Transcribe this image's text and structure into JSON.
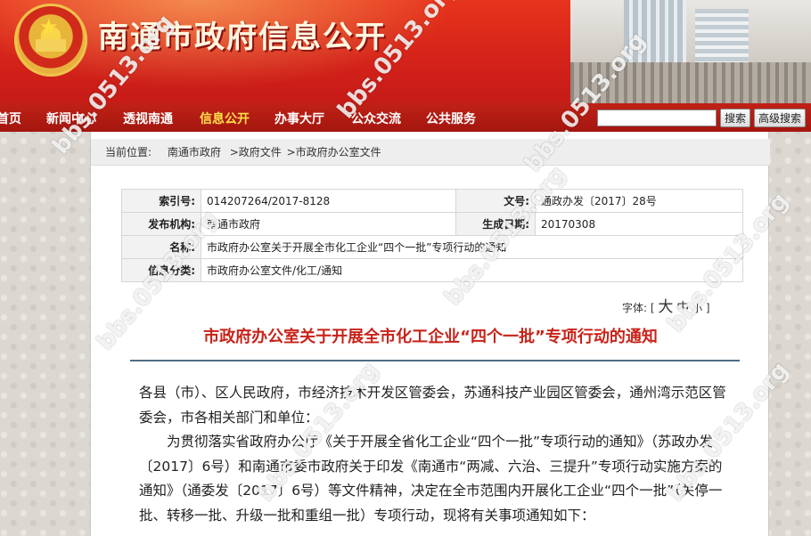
{
  "site": {
    "title": "南通市政府信息公开"
  },
  "nav": {
    "items": [
      {
        "label": "首页"
      },
      {
        "label": "新闻中心"
      },
      {
        "label": "透视南通"
      },
      {
        "label": "信息公开",
        "active": true
      },
      {
        "label": "办事大厅"
      },
      {
        "label": "公众交流"
      },
      {
        "label": "公共服务"
      }
    ],
    "search_value": "",
    "search_button": "搜索",
    "advanced_button": "高级搜索"
  },
  "breadcrumb": {
    "prefix": "当前位置:",
    "links": [
      "南通市政府",
      ">政府文件",
      ">市政府办公室文件"
    ]
  },
  "meta": {
    "index_label": "索引号:",
    "index_value": "014207264/2017-8128",
    "docno_label": "文号:",
    "docno_value": "通政办发〔2017〕28号",
    "issuer_label": "发布机构:",
    "issuer_value": "南通市政府",
    "date_label": "生成日期:",
    "date_value": "20170308",
    "name_label": "名称:",
    "name_value": "市政府办公室关于开展全市化工企业“四个一批”专项行动的通知",
    "category_label": "信息分类:",
    "category_value": "市政府办公室文件/化工/通知"
  },
  "font_size": {
    "label": "字体:",
    "open": "[",
    "large": "大",
    "medium": "中",
    "small": "小",
    "close": "]"
  },
  "document": {
    "title": "市政府办公室关于开展全市化工企业“四个一批”专项行动的通知",
    "paragraphs": [
      "各县（市）、区人民政府，市经济技术开发区管委会，苏通科技产业园区管委会，通州湾示范区管委会，市各相关部门和单位：",
      "为贯彻落实省政府办公厅《关于开展全省化工企业“四个一批”专项行动的通知》（苏政办发〔2017〕6号）和南通市委市政府关于印发《南通市“两减、六治、三提升”专项行动实施方案的通知》（通委发〔2017〕6号）等文件精神，决定在全市范围内开展化工企业“四个一批”（关停一批、转移一批、升级一批和重组一批）专项行动，现将有关事项通知如下："
    ]
  },
  "watermark": {
    "text": "bbs.0513.org"
  },
  "colors": {
    "banner_red": "#d5231a",
    "nav_red": "#b01b12",
    "active_nav": "#ffe04a",
    "title_red": "#c8231a",
    "divider": "#4f6d84"
  }
}
